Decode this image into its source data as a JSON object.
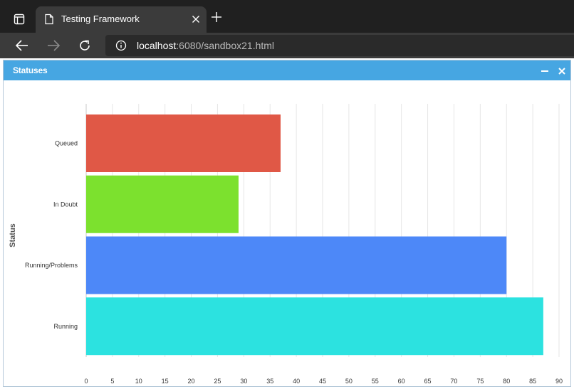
{
  "browser": {
    "tab_title": "Testing Framework",
    "url_host": "localhost",
    "url_rest": ":6080/sandbox21.html"
  },
  "panel": {
    "title": "Statuses"
  },
  "chart_data": {
    "type": "bar",
    "orientation": "horizontal",
    "categories": [
      "Queued",
      "In Doubt",
      "Running/Problems",
      "Running"
    ],
    "values": [
      37,
      29,
      80,
      87
    ],
    "colors": [
      "#e05846",
      "#7ce12e",
      "#4d88f8",
      "#2ce2e0"
    ],
    "xlabel": "",
    "ylabel": "Status",
    "xlim": [
      0,
      90
    ],
    "xticks": [
      0,
      5,
      10,
      15,
      20,
      25,
      30,
      35,
      40,
      45,
      50,
      55,
      60,
      65,
      70,
      75,
      80,
      85,
      90
    ],
    "grid": true,
    "legend": "none"
  }
}
